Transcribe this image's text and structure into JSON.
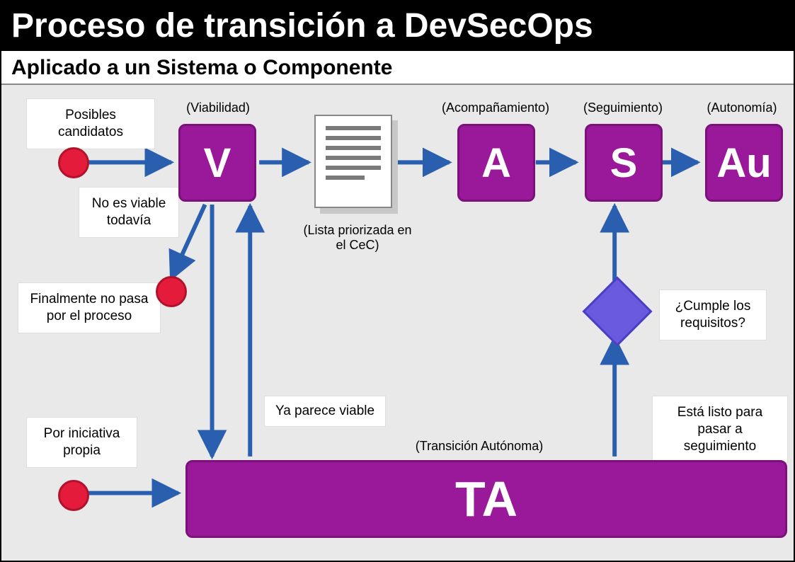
{
  "header": {
    "title": "Proceso de transición a DevSecOps",
    "subtitle": "Aplicado a un Sistema o Componente"
  },
  "stages": {
    "v": {
      "letter": "V",
      "caption": "(Viabilidad)"
    },
    "a": {
      "letter": "A",
      "caption": "(Acompañamiento)"
    },
    "s": {
      "letter": "S",
      "caption": "(Seguimiento)"
    },
    "au": {
      "letter": "Au",
      "caption": "(Autonomía)"
    },
    "ta": {
      "letter": "TA",
      "caption": "(Transición Autónoma)"
    }
  },
  "doc": {
    "caption": "(Lista priorizada en el CeC)"
  },
  "notes": {
    "candidates": "Posibles candidatos",
    "not_viable": "No es viable todavía",
    "no_process": "Finalmente no pasa por el proceso",
    "own_initiative": "Por iniciativa propia",
    "seems_viable": "Ya parece viable",
    "meets_req": "¿Cumple los requisitos?",
    "ready_follow": "Está listo para pasar a seguimiento"
  },
  "colors": {
    "purple": "#9a189a",
    "blue_arrow": "#2a5fb0",
    "red": "#e41b3a",
    "diamond": "#6a5ae0"
  }
}
